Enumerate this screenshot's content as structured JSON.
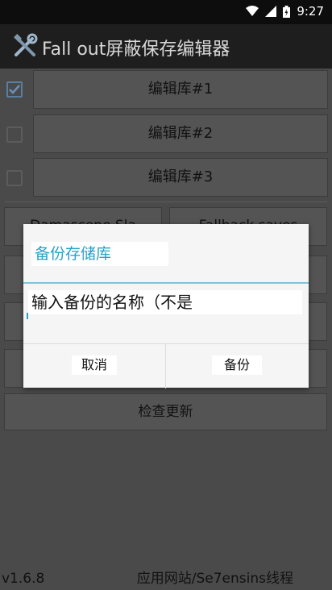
{
  "status_bar": {
    "time": "9:27"
  },
  "app": {
    "title": "Fall out屏蔽保存编辑器"
  },
  "libraries": [
    {
      "label": "编辑库#1",
      "checked": true
    },
    {
      "label": "编辑库#2",
      "checked": false
    },
    {
      "label": "编辑库#3",
      "checked": false
    }
  ],
  "buttons": {
    "row4_left": "Damascene Sla",
    "row4_right": "Fallback saves",
    "check_update": "检查更新"
  },
  "footer": {
    "version": "v1.6.8",
    "link": "应用网站/Se7ensins线程"
  },
  "dialog": {
    "title": "备份存储库",
    "input_value": "输入备份的名称（不是",
    "cancel_label": "取消",
    "confirm_label": "备份"
  },
  "colors": {
    "accent": "#26a3c9",
    "app_bar": "#1e1e1e",
    "status_bar": "#0d0d0d"
  }
}
